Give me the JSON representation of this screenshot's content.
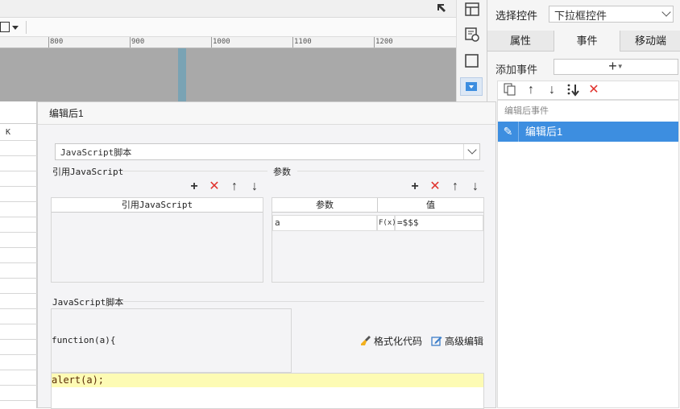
{
  "ruler": {
    "ticks": [
      "800",
      "900",
      "1000",
      "1100",
      "1200"
    ]
  },
  "grid": {
    "column_letter": "K"
  },
  "right_panel": {
    "select_control_label": "选择控件",
    "select_control_value": "下拉框控件",
    "tabs": [
      {
        "label": "属性",
        "active": false
      },
      {
        "label": "事件",
        "active": true
      },
      {
        "label": "移动端",
        "active": false
      }
    ],
    "add_event_label": "添加事件",
    "add_event_button": "+",
    "event_toolbar_icons": [
      "copy-icon",
      "arrow-up-icon",
      "arrow-down-icon",
      "move-bottom-icon",
      "delete-icon"
    ],
    "event_list_header": "编辑后事件",
    "event_items": [
      {
        "label": "编辑后1",
        "selected": true
      }
    ]
  },
  "dialog": {
    "title": "编辑后1",
    "type_select": "JavaScript脚本",
    "ref_js": {
      "section_label": "引用JavaScript",
      "column_header": "引用JavaScript"
    },
    "params": {
      "section_label": "参数",
      "col_param": "参数",
      "col_value": "值",
      "rows": [
        {
          "param": "a",
          "formula_label": "F(x)",
          "value": "=$$$"
        }
      ]
    },
    "script": {
      "section_label": "JavaScript脚本",
      "signature": "function(a){",
      "format_button": "格式化代码",
      "advanced_button": "高级编辑",
      "code_line": "alert(a);"
    }
  },
  "colors": {
    "accent_blue": "#3d8ee0",
    "delete_red": "#e0322d",
    "code_highlight": "#fdfbb4"
  }
}
